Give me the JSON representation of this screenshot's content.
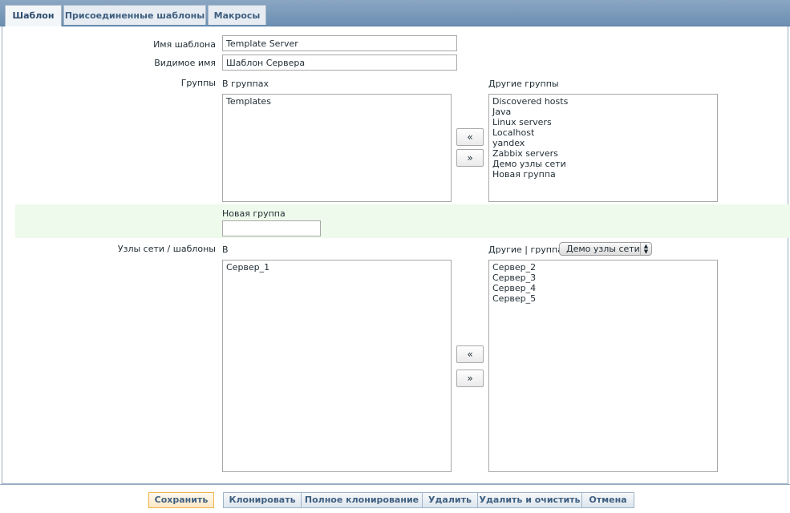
{
  "tabs": [
    {
      "label": "Шаблон",
      "active": true
    },
    {
      "label": "Присоединенные шаблоны",
      "active": false
    },
    {
      "label": "Макросы",
      "active": false
    }
  ],
  "form": {
    "template_name_label": "Имя шаблона",
    "template_name_value": "Template Server",
    "visible_name_label": "Видимое имя",
    "visible_name_value": "Шаблон Сервера",
    "groups_label": "Группы",
    "in_groups_label": "В группах",
    "in_groups": [
      "Templates"
    ],
    "other_groups_label": "Другие группы",
    "other_groups": [
      "Discovered hosts",
      "Java",
      "Linux servers",
      "Localhost",
      "yandex",
      "Zabbix servers",
      "Демо узлы сети",
      "Новая группа"
    ],
    "move_left": "«",
    "move_right": "»",
    "new_group_label": "Новая группа",
    "new_group_value": "",
    "hosts_label": "Узлы сети / шаблоны",
    "in_hosts_label": "В",
    "in_hosts": [
      "Сервер_1"
    ],
    "other_hosts_label": "Другие | группа",
    "group_select_value": "Демо узлы сети",
    "other_hosts": [
      "Сервер_2",
      "Сервер_3",
      "Сервер_4",
      "Сервер_5"
    ]
  },
  "footer": {
    "save": "Сохранить",
    "clone": "Клонировать",
    "full_clone": "Полное клонирование",
    "delete": "Удалить",
    "delete_clear": "Удалить и очистить",
    "cancel": "Отмена"
  },
  "colors": {
    "tab_bar": "#7b9bbb",
    "new_group_row": "#eefaec",
    "primary_button_border": "#f0b24a"
  }
}
